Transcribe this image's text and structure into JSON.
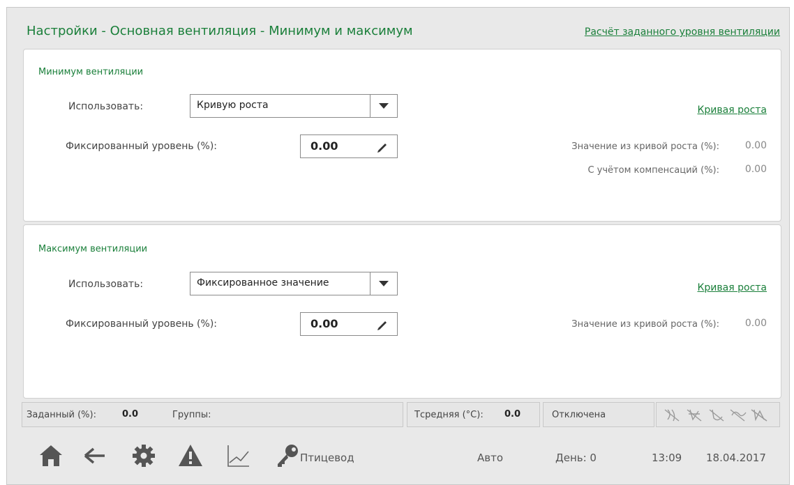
{
  "header": {
    "title": "Настройки - Основная вентиляция - Минимум и максимум",
    "link": "Расчёт заданного уровня вентиляции"
  },
  "min_section": {
    "title": "Минимум вентиляции",
    "use_label": "Использовать:",
    "use_value": "Кривую роста",
    "fixed_label": "Фиксированный уровень (%):",
    "fixed_value": "0.00",
    "curve_link": "Кривая роста",
    "curve_value_label": "Значение из кривой роста (%):",
    "curve_value": "0.00",
    "comp_label": "С учётом компенсаций (%):",
    "comp_value": "0.00"
  },
  "max_section": {
    "title": "Максимум вентиляции",
    "use_label": "Использовать:",
    "use_value": "Фиксированное значение",
    "fixed_label": "Фиксированный уровень (%):",
    "fixed_value": "0.00",
    "curve_link": "Кривая роста",
    "curve_value_label": "Значение из кривой роста (%):",
    "curve_value": "0.00"
  },
  "status_bar": {
    "set_label": "Заданный (%):",
    "set_value": "0.0",
    "groups_label": "Группы:",
    "tavg_label": "Тсредняя (°C):",
    "tavg_value": "0.0",
    "state": "Отключена"
  },
  "bottom_bar": {
    "icons": [
      "home-icon",
      "back-arrow-icon",
      "gear-icon",
      "warning-icon",
      "chart-icon",
      "key-icon"
    ],
    "user": "Птицевод",
    "mode": "Авто",
    "day": "День: 0",
    "time": "13:09",
    "date": "18.04.2017"
  },
  "colors": {
    "accent": "#1a7f3a",
    "icon": "#555555"
  }
}
